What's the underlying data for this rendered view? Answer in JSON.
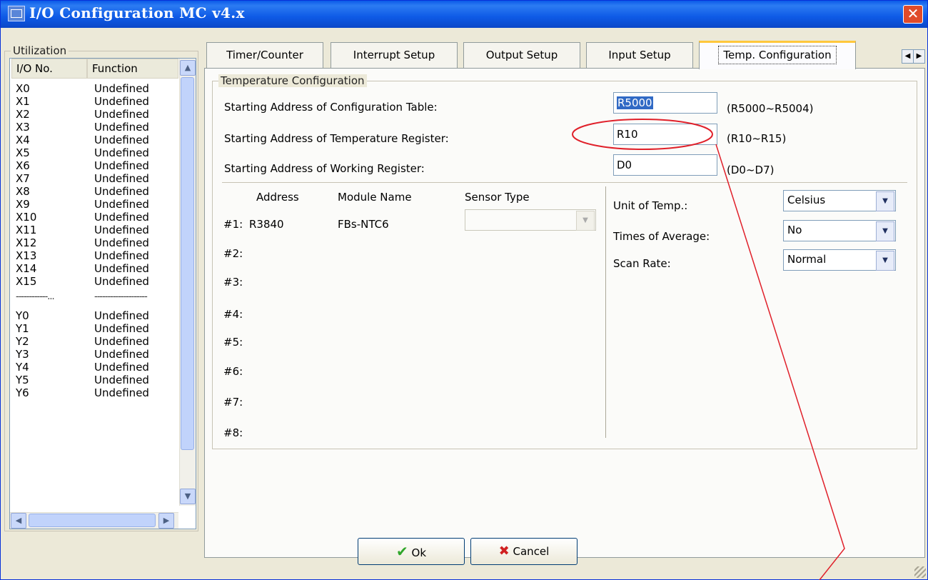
{
  "window": {
    "title": "I/O Configuration MC v4.x",
    "close_label": "✕"
  },
  "utilization": {
    "group_label": "Utilization",
    "headers": {
      "io_no": "I/O No.",
      "function": "Function"
    },
    "rows": [
      {
        "io": "X0",
        "fn": "Undefined"
      },
      {
        "io": "X1",
        "fn": "Undefined"
      },
      {
        "io": "X2",
        "fn": "Undefined"
      },
      {
        "io": "X3",
        "fn": "Undefined"
      },
      {
        "io": "X4",
        "fn": "Undefined"
      },
      {
        "io": "X5",
        "fn": "Undefined"
      },
      {
        "io": "X6",
        "fn": "Undefined"
      },
      {
        "io": "X7",
        "fn": "Undefined"
      },
      {
        "io": "X8",
        "fn": "Undefined"
      },
      {
        "io": "X9",
        "fn": "Undefined"
      },
      {
        "io": "X10",
        "fn": "Undefined"
      },
      {
        "io": "X11",
        "fn": "Undefined"
      },
      {
        "io": "X12",
        "fn": "Undefined"
      },
      {
        "io": "X13",
        "fn": "Undefined"
      },
      {
        "io": "X14",
        "fn": "Undefined"
      },
      {
        "io": "X15",
        "fn": "Undefined"
      },
      {
        "io": "------------...",
        "fn": "--------------------",
        "separator": true
      },
      {
        "io": "Y0",
        "fn": "Undefined"
      },
      {
        "io": "Y1",
        "fn": "Undefined"
      },
      {
        "io": "Y2",
        "fn": "Undefined"
      },
      {
        "io": "Y3",
        "fn": "Undefined"
      },
      {
        "io": "Y4",
        "fn": "Undefined"
      },
      {
        "io": "Y5",
        "fn": "Undefined"
      },
      {
        "io": "Y6",
        "fn": "Undefined"
      }
    ]
  },
  "tabs": [
    {
      "label": "Timer/Counter",
      "active": false
    },
    {
      "label": "Interrupt Setup",
      "active": false
    },
    {
      "label": "Output Setup",
      "active": false
    },
    {
      "label": "Input Setup",
      "active": false
    },
    {
      "label": "Temp. Configuration",
      "active": true
    }
  ],
  "temp_config": {
    "group_label": "Temperature Configuration",
    "config_table": {
      "label": "Starting Address of Configuration Table:",
      "value": "R5000",
      "range": "(R5000~R5004)"
    },
    "temp_register": {
      "label": "Starting Address of Temperature Register:",
      "value": "R10",
      "range": "(R10~R15)"
    },
    "working_register": {
      "label": "Starting Address of Working Register:",
      "value": "D0",
      "range": "(D0~D7)"
    },
    "module_headers": {
      "address": "Address",
      "module_name": "Module Name",
      "sensor_type": "Sensor Type"
    },
    "modules": [
      {
        "num": "#1:",
        "address": "R3840",
        "module_name": "FBs-NTC6",
        "sensor_type": ""
      },
      {
        "num": "#2:"
      },
      {
        "num": "#3:"
      },
      {
        "num": "#4:"
      },
      {
        "num": "#5:"
      },
      {
        "num": "#6:"
      },
      {
        "num": "#7:"
      },
      {
        "num": "#8:"
      }
    ],
    "unit_of_temp": {
      "label": "Unit of Temp.:",
      "value": "Celsius"
    },
    "times_of_average": {
      "label": "Times of Average:",
      "value": "No"
    },
    "scan_rate": {
      "label": "Scan Rate:",
      "value": "Normal"
    }
  },
  "buttons": {
    "ok": "Ok",
    "cancel": "Cancel"
  },
  "colors": {
    "titlebar": "#0a5ae8",
    "annotation": "#e0202a",
    "ok_check": "#2fa62a",
    "cancel_x": "#d02020"
  }
}
